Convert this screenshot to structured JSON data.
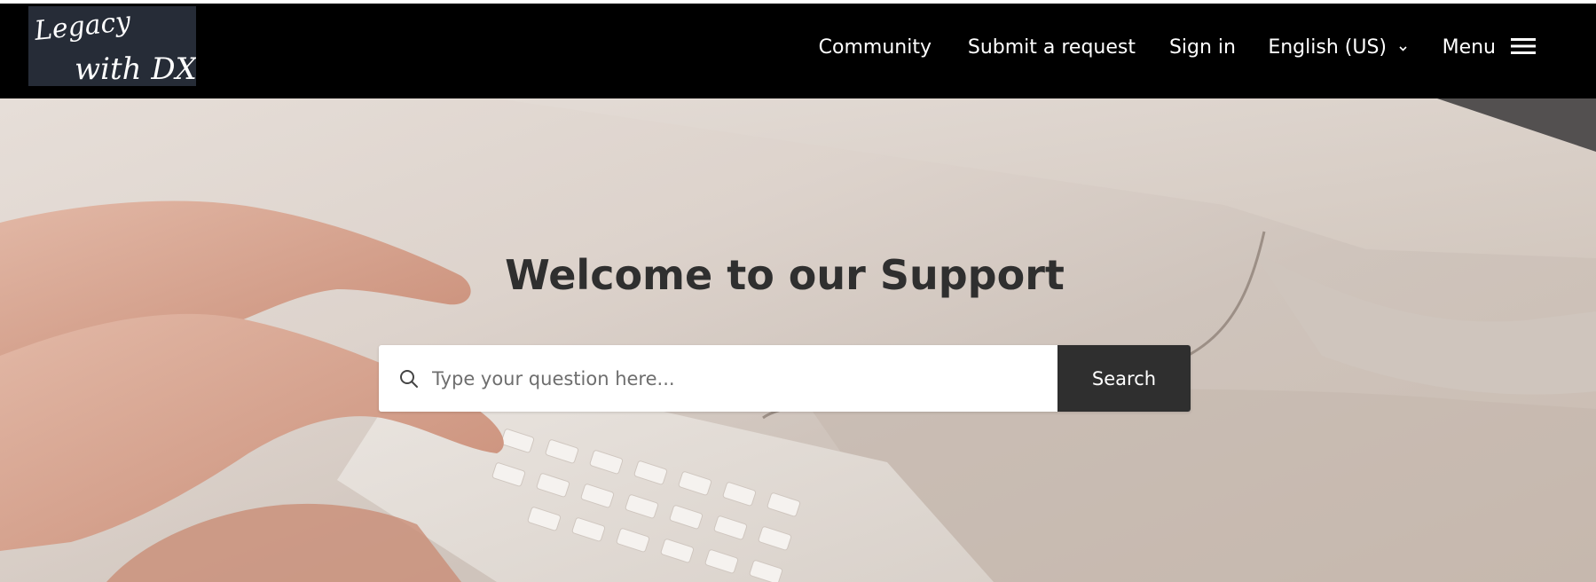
{
  "brand": {
    "logo_line1": "Legacy",
    "logo_line2": "with DX"
  },
  "nav": {
    "community": "Community",
    "submit_request": "Submit a request",
    "sign_in": "Sign in",
    "language": "English (US)",
    "menu": "Menu"
  },
  "hero": {
    "title": "Welcome to our Support"
  },
  "search": {
    "placeholder": "Type your question here...",
    "button_label": "Search"
  },
  "colors": {
    "header_bg": "#000000",
    "header_text": "#ffffff",
    "title_text": "#2f2f2f",
    "search_button_bg": "#2f2f2f"
  },
  "icons": {
    "search": "search-icon",
    "menu": "hamburger-icon",
    "language": "chevron-down-icon"
  }
}
